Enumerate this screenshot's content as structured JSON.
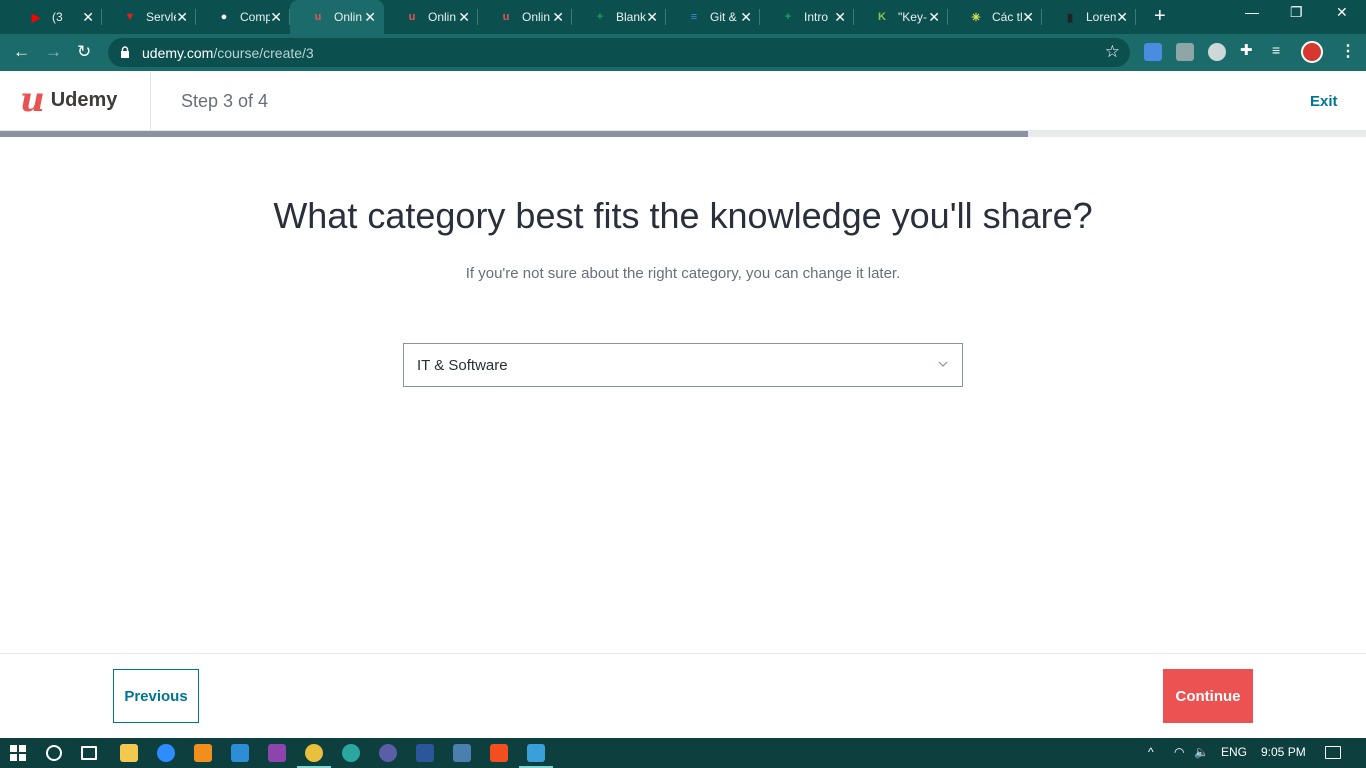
{
  "browser": {
    "tabs": [
      {
        "title": "(3",
        "favicon": "youtube-icon",
        "color": "#ff0000",
        "active": false
      },
      {
        "title": "Servle",
        "favicon": "tv-icon",
        "color": "#e02020",
        "active": false
      },
      {
        "title": "Comp",
        "favicon": "github-icon",
        "color": "#ffffff",
        "active": false
      },
      {
        "title": "Onlin",
        "favicon": "udemy-icon",
        "color": "#ea5252",
        "active": true
      },
      {
        "title": "Onlin",
        "favicon": "udemy-icon",
        "color": "#ea5252",
        "active": false
      },
      {
        "title": "Onlin",
        "favicon": "udemy-icon",
        "color": "#ea5252",
        "active": false
      },
      {
        "title": "Blank",
        "favicon": "sheets-icon",
        "color": "#1ea362",
        "active": false
      },
      {
        "title": "Git &",
        "favicon": "docs-icon",
        "color": "#4285f4",
        "active": false
      },
      {
        "title": "Intro",
        "favicon": "sheets-icon",
        "color": "#1ea362",
        "active": false
      },
      {
        "title": "\"Key-",
        "favicon": "k-icon",
        "color": "#8bc34a",
        "active": false
      },
      {
        "title": "Các tl",
        "favicon": "loading-icon",
        "color": "#e8e84a",
        "active": false
      },
      {
        "title": "Lorem",
        "favicon": "document-icon",
        "color": "#222222",
        "active": false
      }
    ],
    "url_host": "udemy.com",
    "url_path": "/course/create/3"
  },
  "header": {
    "logo_text": "Udemy",
    "step_text": "Step 3 of 4",
    "exit_label": "Exit"
  },
  "progress": {
    "fraction": 0.75
  },
  "main": {
    "question": "What category best fits the knowledge you'll share?",
    "hint": "If you're not sure about the right category, you can change it later.",
    "category_value": "IT & Software"
  },
  "footer": {
    "previous_label": "Previous",
    "continue_label": "Continue"
  },
  "taskbar": {
    "language": "ENG",
    "time": "9:05 PM"
  },
  "colors": {
    "brand": "#ea5252",
    "link": "#007791",
    "chrome_frame": "#0b4f4f"
  }
}
